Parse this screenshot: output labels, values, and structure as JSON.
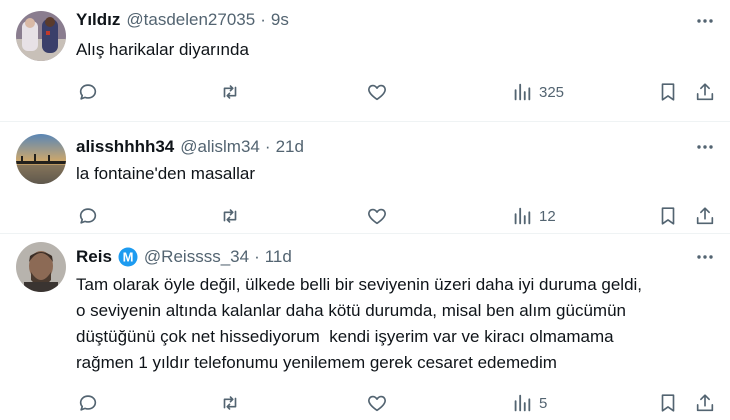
{
  "tweets": [
    {
      "name": "Yıldız",
      "handle": "@tasdelen27035",
      "separator": "·",
      "time": "9s",
      "text": "Alış harikalar diyarında",
      "stats": {
        "replies": "",
        "retweets": "",
        "likes": "",
        "views": "325"
      }
    },
    {
      "name": "alisshhhh34",
      "handle": "@alislm34",
      "separator": "·",
      "time": "21d",
      "text": "la fontaine'den masallar",
      "stats": {
        "replies": "",
        "retweets": "",
        "likes": "",
        "views": "12"
      }
    },
    {
      "name": "Reis",
      "badge_letter": "M",
      "handle": "@Reissss_34",
      "separator": "·",
      "time": "11d",
      "text_lines": [
        "Tam olarak öyle değil, ülkede belli bir seviyenin üzeri daha iyi duruma geldi,",
        "o seviyenin altında kalanlar daha kötü durumda, misal ben alım gücümün",
        "düştüğünü çok net hissediyorum  kendi işyerim var ve kiracı olmamama",
        "rağmen 1 yıldır telefonumu yenilemem gerek cesaret edemedim"
      ],
      "stats": {
        "replies": "",
        "retweets": "",
        "likes": "",
        "views": "5"
      }
    }
  ],
  "icons": {
    "reply": "reply-icon",
    "retweet": "retweet-icon",
    "like": "heart-icon",
    "views": "views-chart-icon",
    "bookmark": "bookmark-icon",
    "share": "share-icon",
    "more": "more-dots-icon",
    "badge": "badge-icon"
  },
  "colors": {
    "text": "#0f1419",
    "muted": "#536471",
    "divider": "#eff3f4",
    "badge": "#1d9bf0"
  }
}
